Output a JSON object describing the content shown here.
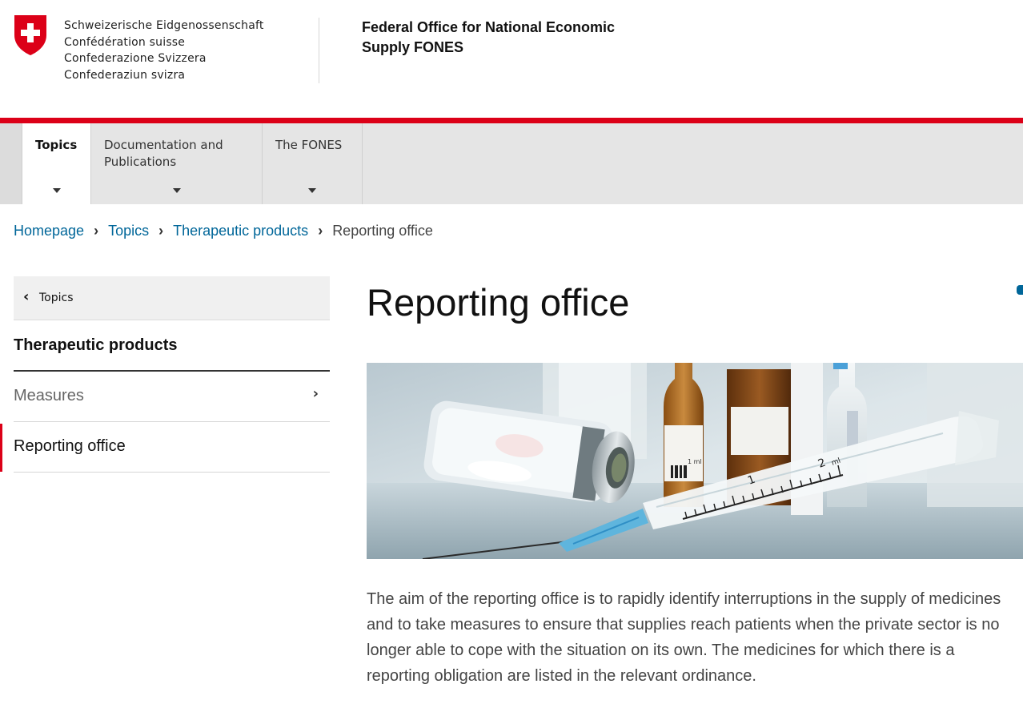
{
  "header": {
    "confederation_names": [
      "Schweizerische Eidgenossenschaft",
      "Confédération suisse",
      "Confederazione Svizzera",
      "Confederaziun svizra"
    ],
    "office_title_line1": "Federal Office for National Economic",
    "office_title_line2": "Supply FONES",
    "logo_icon": "swiss-cross-shield"
  },
  "nav": {
    "tabs": [
      {
        "line1": "Topics",
        "line2": "",
        "active": true
      },
      {
        "line1": "Documentation and",
        "line2": "Publications",
        "active": false
      },
      {
        "line1": "The FONES",
        "line2": "",
        "active": false
      }
    ]
  },
  "breadcrumb": {
    "items": [
      "Homepage",
      "Topics",
      "Therapeutic products"
    ],
    "separator": "›",
    "current": "Reporting office"
  },
  "sidenav": {
    "back_label": "Topics",
    "back_icon": "chevron-left-icon",
    "heading": "Therapeutic products",
    "items": [
      {
        "label": "Measures",
        "has_children": true,
        "active": false
      },
      {
        "label": "Reporting office",
        "has_children": false,
        "active": true
      }
    ]
  },
  "main": {
    "title": "Reporting office",
    "image_subject": "syringe-and-medicine-vials",
    "syringe_markings": [
      "1",
      "2",
      "ml"
    ],
    "paragraph": "The aim of the reporting office is to rapidly identify interruptions in the supply of medicines and to take measures to ensure that supplies reach patients when the private sector is no longer able to cope with the situation on its own. The medicines for which there is a reporting obligation are listed in the relevant ordinance."
  },
  "colors": {
    "accent_red": "#dc0018",
    "link_blue": "#006699",
    "nav_background": "#e5e5e5"
  }
}
